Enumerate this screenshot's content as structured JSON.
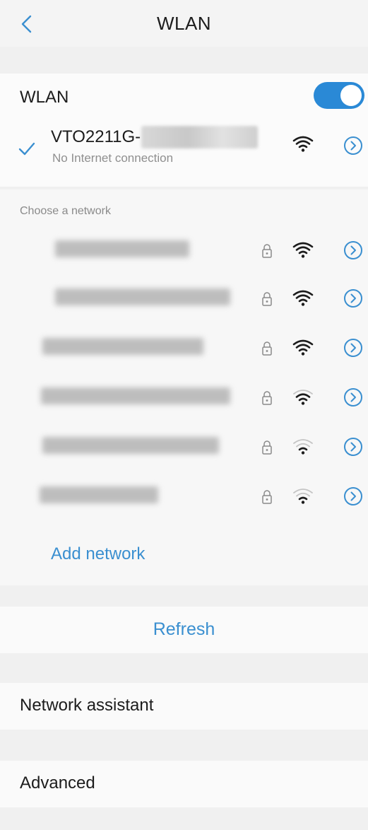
{
  "header": {
    "title": "WLAN"
  },
  "wlan_toggle": {
    "label": "WLAN",
    "enabled": true,
    "accent_color": "#2a89d6"
  },
  "connected": {
    "ssid_visible": "VTO2211G-",
    "status": "No Internet connection",
    "secured": false,
    "signal_level": 4
  },
  "networks_section": {
    "label": "Choose a network",
    "items": [
      {
        "name_blurred": true,
        "secured": true,
        "signal_level": 4
      },
      {
        "name_blurred": true,
        "secured": true,
        "signal_level": 4
      },
      {
        "name_blurred": true,
        "secured": true,
        "signal_level": 4
      },
      {
        "name_blurred": true,
        "secured": true,
        "signal_level": 3
      },
      {
        "name_blurred": true,
        "secured": true,
        "signal_level": 2
      },
      {
        "name_blurred": true,
        "secured": true,
        "signal_level": 2
      }
    ]
  },
  "add_network_label": "Add network",
  "refresh_label": "Refresh",
  "menu": {
    "network_assistant": "Network assistant",
    "advanced": "Advanced"
  },
  "link_color": "#3a8fd0",
  "icons": {
    "back": "back-icon",
    "check": "check-icon",
    "lock": "lock-icon",
    "wifi": "wifi-icon",
    "detail": "chevron-right-circle-icon"
  }
}
